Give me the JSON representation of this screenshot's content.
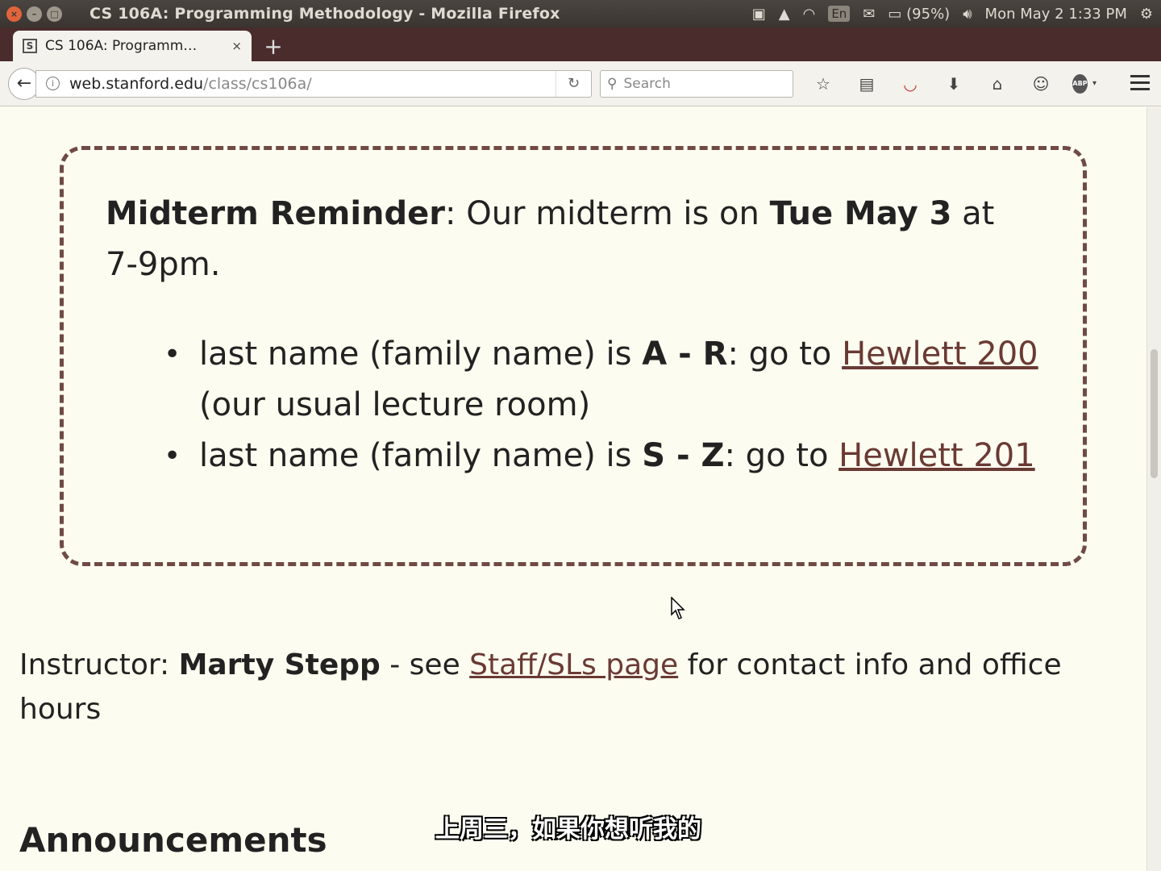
{
  "window": {
    "title": "CS 106A: Programming Methodology - Mozilla Firefox"
  },
  "panel": {
    "language": "En",
    "battery": "(95%)",
    "clock": "Mon May  2  1:33 PM"
  },
  "tab": {
    "label": "CS 106A: Programm…",
    "favicon_letter": "S",
    "close": "×"
  },
  "nav": {
    "url_host": "web.stanford.edu",
    "url_path": "/class/cs106a/",
    "search_placeholder": "Search"
  },
  "reminder": {
    "title": "Midterm Reminder",
    "intro": ": Our midterm is on ",
    "date": "Tue May 3",
    "time": " at 7-9pm.",
    "items": [
      {
        "prefix": "last name (family name) is ",
        "range": "A - R",
        "middle": ": go to ",
        "link": "Hewlett 200",
        "suffix": " (our usual lecture room)"
      },
      {
        "prefix": "last name (family name) is ",
        "range": "S - Z",
        "middle": ": go to ",
        "link": "Hewlett 201",
        "suffix": ""
      }
    ]
  },
  "instructor": {
    "label": "Instructor: ",
    "name": "Marty Stepp",
    "see": " - see ",
    "link": "Staff/SLs page",
    "rest": " for contact info and office hours"
  },
  "announcements": {
    "heading": "Announcements"
  },
  "subtitle": "上周三，如果你想听我的"
}
